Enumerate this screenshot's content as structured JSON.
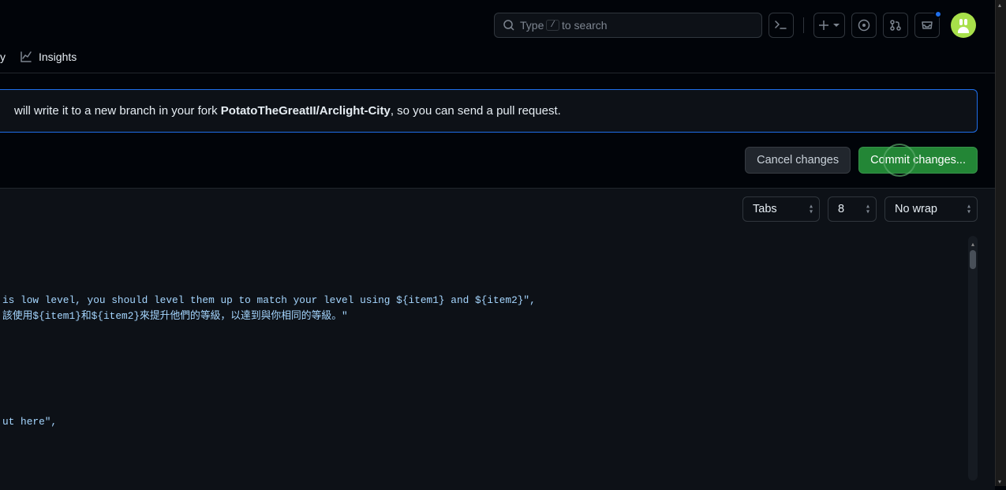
{
  "header": {
    "search_prefix": "Type",
    "search_key": "/",
    "search_suffix": "to search"
  },
  "nav": {
    "partial_tab": "y",
    "insights_label": "Insights"
  },
  "banner": {
    "text_prefix": "will write it to a new branch in your fork ",
    "repo": "PotatoTheGreatII/Arclight-City",
    "text_suffix": ", so you can send a pull request."
  },
  "actions": {
    "cancel_label": "Cancel changes",
    "commit_label": "Commit changes..."
  },
  "editor_toolbar": {
    "indent_mode": "Tabs",
    "indent_size": "8",
    "wrap_mode": "No wrap"
  },
  "code": {
    "line1": "is low level, you should level them up to match your level using ${item1} and ${item2}\",",
    "line2": "該使用${item1}和${item2}來提升他們的等級，以達到與你相同的等級。\"",
    "line3": "ut here\","
  }
}
